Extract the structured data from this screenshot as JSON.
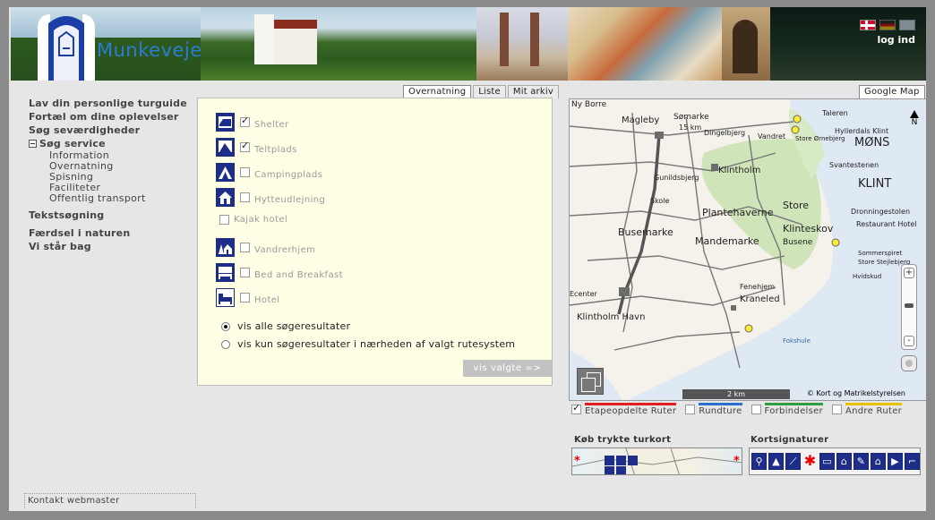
{
  "header": {
    "site_title": "Munkevejen",
    "login_label": "log ind",
    "languages": [
      "dansk",
      "deutsch",
      "english"
    ]
  },
  "left_nav": {
    "items_top": [
      "Lav din personlige turguide",
      "Fortæl om dine oplevelser",
      "Søg seværdigheder"
    ],
    "expanded_label": "Søg service",
    "sub_items": [
      "Information",
      "Overnatning",
      "Spisning",
      "Faciliteter",
      "Offentlig transport"
    ],
    "items_bottom": [
      "Tekstsøgning",
      "Færdsel i naturen",
      "Vi står bag"
    ]
  },
  "footer": {
    "contact_label": "Kontakt webmaster"
  },
  "search_tabs": [
    "Overnatning",
    "Liste",
    "Mit arkiv"
  ],
  "services": [
    {
      "label": "Shelter",
      "checked": true,
      "icon": "shelter-icon"
    },
    {
      "label": "Teltplads",
      "checked": true,
      "icon": "tent-icon"
    },
    {
      "label": "Campingplads",
      "checked": false,
      "icon": "camping-icon"
    },
    {
      "label": "Hytteudlejning",
      "checked": false,
      "icon": "cabin-icon"
    },
    {
      "label": "Kajak hotel",
      "checked": false,
      "icon": ""
    },
    {
      "label": "Vandrerhjem",
      "checked": false,
      "icon": "hostel-icon"
    },
    {
      "label": "Bed and Breakfast",
      "checked": false,
      "icon": "bed-breakfast-icon"
    },
    {
      "label": "Hotel",
      "checked": false,
      "icon": "hotel-icon"
    }
  ],
  "result_options": [
    {
      "label": "vis alle søgeresultater",
      "selected": true
    },
    {
      "label": "vis kun søgeresultater i nærheden af valgt rutesystem",
      "selected": false
    }
  ],
  "show_selected_label": "vis valgte =>",
  "map": {
    "tab_label": "Google Map",
    "north_label": "N",
    "scale_label": "2 km",
    "copyright": "© Kort og Matrikelstyrelsen",
    "place_names": [
      "Ny Borre",
      "Magleby",
      "Sømarke",
      "15 km",
      "Dingelbjerg",
      "Vandret",
      "Store Ørnebjerg",
      "Taleren",
      "Hyllerdals Klint",
      "MØNS",
      "KLINT",
      "Svantestenen",
      "Klintholm",
      "Gunildsbjerg",
      "Skole",
      "Plantehaverne",
      "Store",
      "Dronningestolen",
      "Restaurant Hotel",
      "Busemarke",
      "Mandemarke",
      "Klinteskov",
      "Busene",
      "Sommerspiret",
      "Store Stejlebjerg",
      "Hvidskud",
      "Fenehjem",
      "Kraneled",
      "Klintholm Havn",
      "Ecenter",
      "Fokshule"
    ]
  },
  "route_legend": [
    {
      "label": "Etapeopdelte Ruter",
      "checked": true,
      "color": "#e02020"
    },
    {
      "label": "Rundture",
      "checked": false,
      "color": "#2a6fd0"
    },
    {
      "label": "Forbindelser",
      "checked": false,
      "color": "#2ca040"
    },
    {
      "label": "Andre Ruter",
      "checked": false,
      "color": "#e6c200"
    }
  ],
  "buy_maps_title": "Køb trykte turkort",
  "map_symbols_title": "Kortsignaturer",
  "colors": {
    "accent_blue": "#2a7dd0",
    "icon_navy": "#1c2d8a",
    "panel_bg": "#ffffe6"
  }
}
